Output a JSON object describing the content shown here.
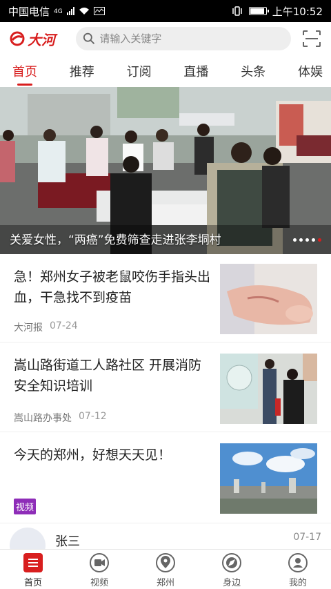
{
  "status": {
    "carrier": "中国电信",
    "network": "4G",
    "time": "上午10:52"
  },
  "header": {
    "logo_text": "大河",
    "search_placeholder": "请输入关键字"
  },
  "tabs": [
    {
      "label": "首页",
      "active": true
    },
    {
      "label": "推荐",
      "active": false
    },
    {
      "label": "订阅",
      "active": false
    },
    {
      "label": "直播",
      "active": false
    },
    {
      "label": "头条",
      "active": false
    },
    {
      "label": "体娱",
      "active": false
    }
  ],
  "banner": {
    "caption": "关爱女性，“两癌”免费筛查走进张李垌村",
    "slide_count": 5,
    "active_slide": 5
  },
  "news": [
    {
      "title": "急！郑州女子被老鼠咬伤手指头出血，干急找不到疫苗",
      "source": "大河报",
      "date": "07-24"
    },
    {
      "title": "嵩山路街道工人路社区 开展消防安全知识培训",
      "source": "嵩山路办事处",
      "date": "07-12"
    },
    {
      "title": "今天的郑州，好想天天见！",
      "badge": "视频"
    }
  ],
  "user_post": {
    "name": "张三",
    "date": "07-17"
  },
  "bottom_nav": [
    {
      "label": "首页",
      "icon": "home-list-icon",
      "active": true
    },
    {
      "label": "视频",
      "icon": "video-icon",
      "active": false
    },
    {
      "label": "郑州",
      "icon": "location-pin-icon",
      "active": false
    },
    {
      "label": "身边",
      "icon": "nearby-compass-icon",
      "active": false
    },
    {
      "label": "我的",
      "icon": "user-profile-icon",
      "active": false
    }
  ],
  "colors": {
    "brand": "#d81e1e",
    "video_badge": "#8e2db8"
  }
}
